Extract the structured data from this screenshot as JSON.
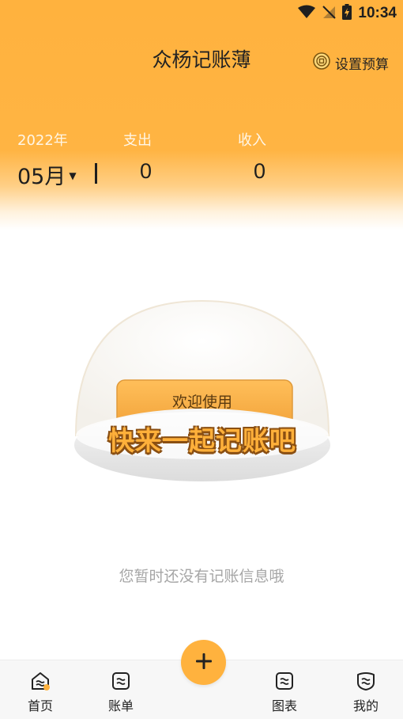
{
  "status_bar": {
    "time": "10:34"
  },
  "header": {
    "title": "众杨记账薄",
    "budget_label": "设置预算"
  },
  "summary": {
    "year_label": "2022年",
    "month_value": "05月",
    "expense_label": "支出",
    "expense_value": "0",
    "income_label": "收入",
    "income_value": "0"
  },
  "empty_state": {
    "banner_small": "欢迎使用",
    "banner_big": "快来一起记账吧",
    "message": "您暂时还没有记账信息哦"
  },
  "bottom_nav": {
    "items": [
      {
        "label": "首页",
        "icon": "home-icon"
      },
      {
        "label": "账单",
        "icon": "bill-icon"
      },
      {
        "label": "图表",
        "icon": "chart-icon"
      },
      {
        "label": "我的",
        "icon": "profile-icon"
      }
    ],
    "fab_icon": "plus-icon"
  },
  "colors": {
    "accent": "#ffb23e",
    "text_dark": "#222222",
    "muted": "#a6a6a6"
  }
}
